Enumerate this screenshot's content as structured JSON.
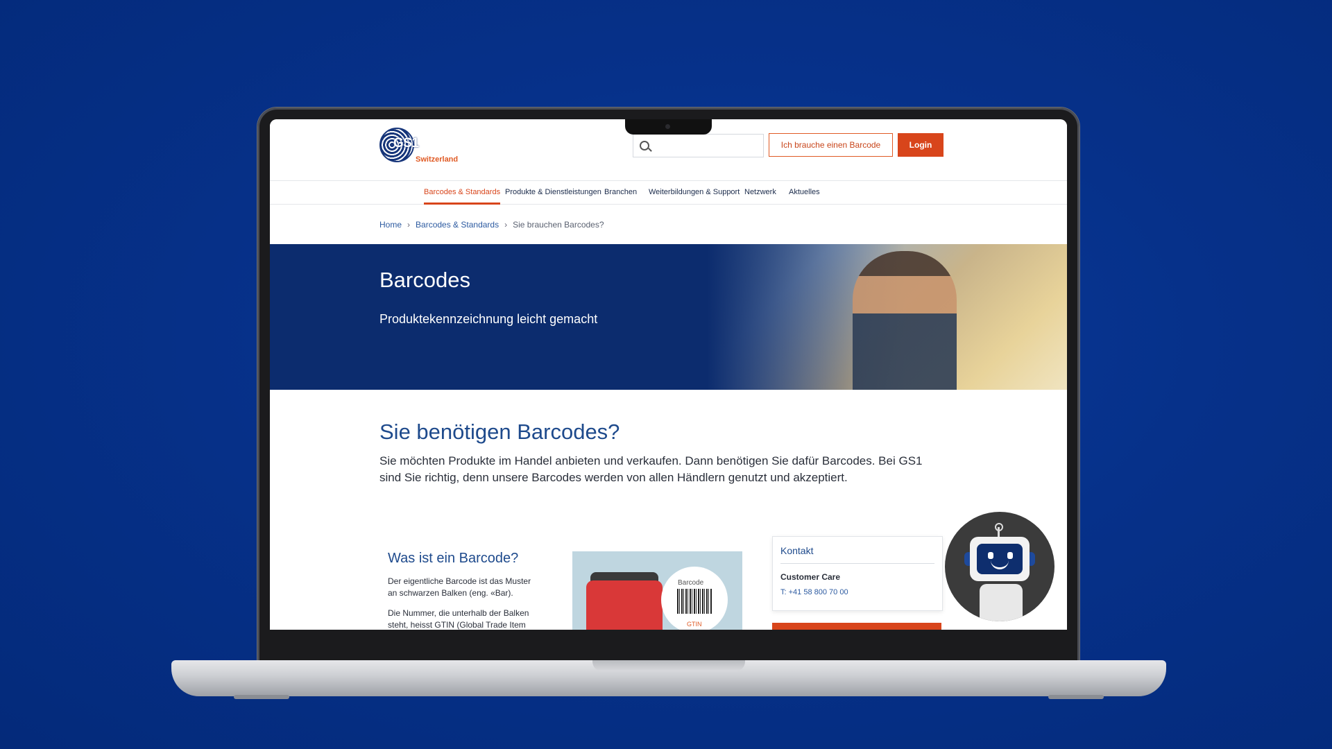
{
  "site": {
    "logo": {
      "mark": "GS1",
      "region": "Switzerland"
    },
    "search": {
      "placeholder": ""
    },
    "header_buttons": {
      "need_barcode": "Ich brauche einen Barcode",
      "login": "Login"
    },
    "nav": [
      {
        "label": "Barcodes & Standards",
        "active": true
      },
      {
        "label": "Produkte & Dienstleistungen",
        "active": false
      },
      {
        "label": "Branchen",
        "active": false
      },
      {
        "label": "Weiterbildungen & Support",
        "active": false
      },
      {
        "label": "Netzwerk",
        "active": false
      },
      {
        "label": "Aktuelles",
        "active": false
      }
    ],
    "breadcrumb": [
      "Home",
      "Barcodes & Standards",
      "Sie brauchen Barcodes?"
    ],
    "hero": {
      "title": "Barcodes",
      "subtitle": "Produktekennzeichnung leicht gemacht"
    },
    "main": {
      "heading": "Sie benötigen Barcodes?",
      "intro": "Sie möchten Produkte im Handel anbieten und verkaufen. Dann benötigen Sie dafür Barcodes. Bei GS1 sind Sie richtig, denn unsere Barcodes werden von allen Händlern genutzt und akzeptiert.",
      "what_heading": "Was ist ein Barcode?",
      "what_p1": "Der eigentliche Barcode ist das Muster an schwarzen Balken (eng. «Bar).",
      "what_p2": "Die Nummer, die unterhalb der Balken steht, heisst GTIN (Global Trade Item",
      "illustration": {
        "barcode_label": "Barcode",
        "gtin_label": "GTIN"
      }
    },
    "contact": {
      "title": "Kontakt",
      "name": "Customer Care",
      "phone": "T: +41 58 800 70 00"
    }
  },
  "colors": {
    "brand_blue": "#0c2c6e",
    "accent_orange": "#d8451b",
    "link_blue": "#2c5aa0",
    "background": "#06318a"
  },
  "icons": [
    "search-icon",
    "chevron-right-icon",
    "chatbot-robot-icon"
  ]
}
